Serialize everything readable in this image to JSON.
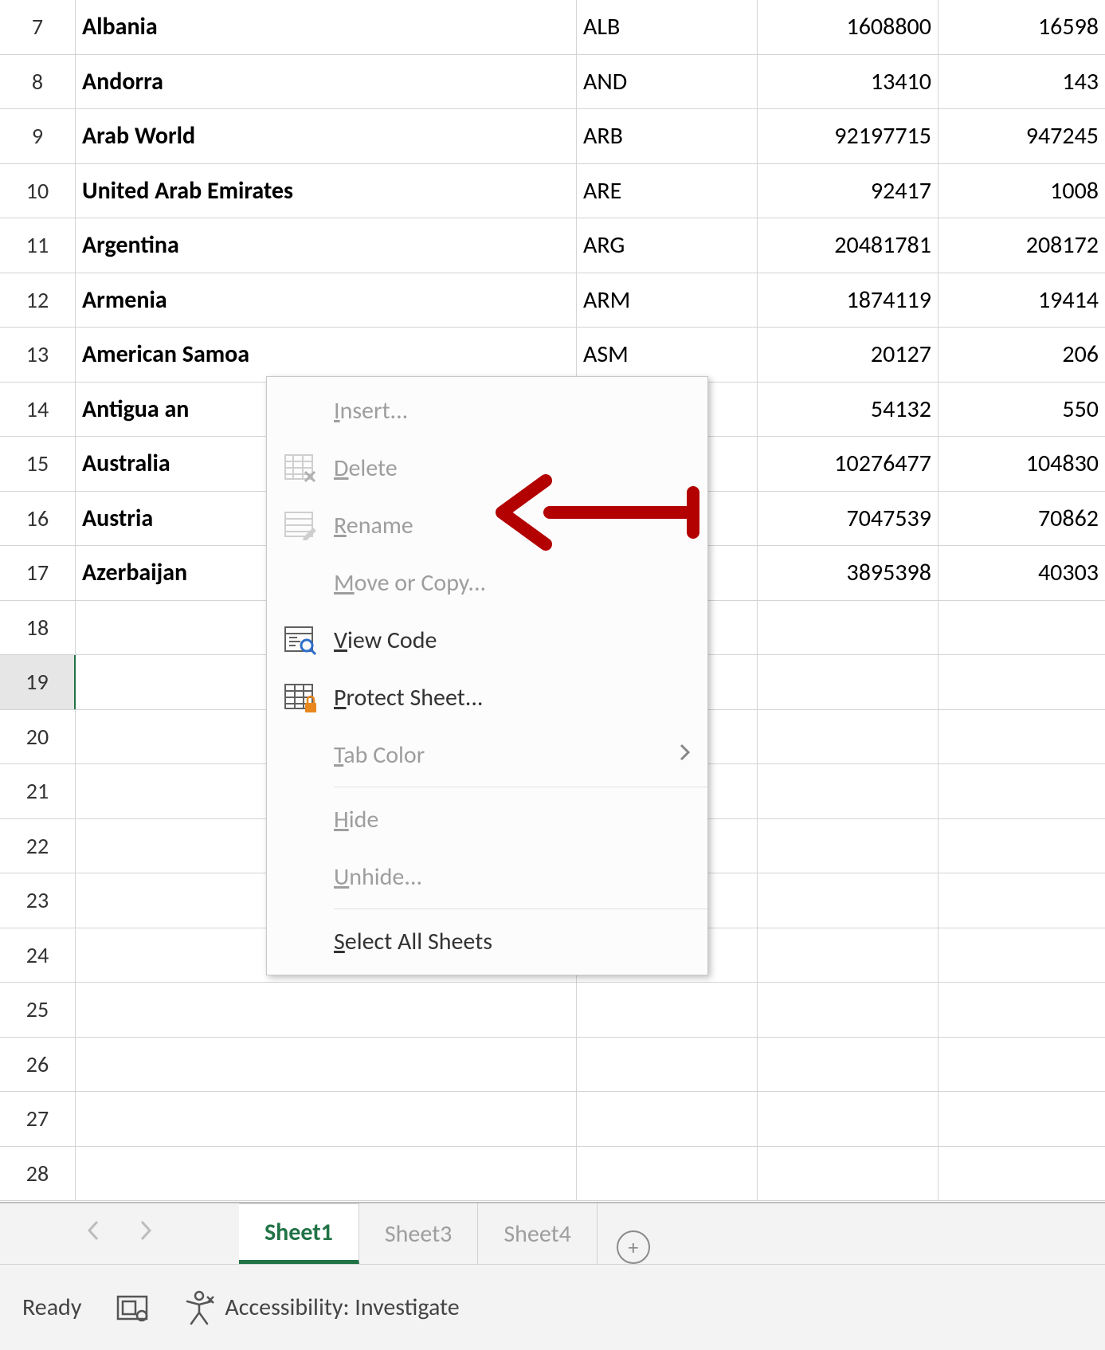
{
  "rows": [
    {
      "n": "7",
      "a": "Albania",
      "b": "ALB",
      "c": "1608800",
      "d": "16598"
    },
    {
      "n": "8",
      "a": "Andorra",
      "b": "AND",
      "c": "13410",
      "d": "143"
    },
    {
      "n": "9",
      "a": "Arab World",
      "b": "ARB",
      "c": "92197715",
      "d": "947245"
    },
    {
      "n": "10",
      "a": "United Arab Emirates",
      "b": "ARE",
      "c": "92417",
      "d": "1008"
    },
    {
      "n": "11",
      "a": "Argentina",
      "b": "ARG",
      "c": "20481781",
      "d": "208172"
    },
    {
      "n": "12",
      "a": "Armenia",
      "b": "ARM",
      "c": "1874119",
      "d": "19414"
    },
    {
      "n": "13",
      "a": "American Samoa",
      "b": "ASM",
      "c": "20127",
      "d": "206"
    },
    {
      "n": "14",
      "a": "Antigua an",
      "b": "",
      "c": "54132",
      "d": "550"
    },
    {
      "n": "15",
      "a": "Australia",
      "b": "",
      "c": "10276477",
      "d": "104830"
    },
    {
      "n": "16",
      "a": "Austria",
      "b": "",
      "c": "7047539",
      "d": "70862"
    },
    {
      "n": "17",
      "a": "Azerbaijan",
      "b": "",
      "c": "3895398",
      "d": "40303"
    },
    {
      "n": "18",
      "a": "",
      "b": "",
      "c": "",
      "d": ""
    },
    {
      "n": "19",
      "a": "",
      "b": "",
      "c": "",
      "d": "",
      "selected": true
    },
    {
      "n": "20",
      "a": "",
      "b": "",
      "c": "",
      "d": ""
    },
    {
      "n": "21",
      "a": "",
      "b": "",
      "c": "",
      "d": ""
    },
    {
      "n": "22",
      "a": "",
      "b": "",
      "c": "",
      "d": ""
    },
    {
      "n": "23",
      "a": "",
      "b": "",
      "c": "",
      "d": ""
    },
    {
      "n": "24",
      "a": "",
      "b": "",
      "c": "",
      "d": ""
    },
    {
      "n": "25",
      "a": "",
      "b": "",
      "c": "",
      "d": ""
    },
    {
      "n": "26",
      "a": "",
      "b": "",
      "c": "",
      "d": ""
    },
    {
      "n": "27",
      "a": "",
      "b": "",
      "c": "",
      "d": ""
    },
    {
      "n": "28",
      "a": "",
      "b": "",
      "c": "",
      "d": ""
    }
  ],
  "menu": {
    "insert": "Insert...",
    "delete": "Delete",
    "rename": "Rename",
    "move_copy": "Move or Copy...",
    "view_code": "View Code",
    "protect": "Protect Sheet...",
    "tab_color": "Tab Color",
    "hide": "Hide",
    "unhide": "Unhide...",
    "select_all": "Select All Sheets"
  },
  "tabs": {
    "sheet1": "Sheet1",
    "sheet3": "Sheet3",
    "sheet4": "Sheet4"
  },
  "status": {
    "ready": "Ready",
    "accessibility": "Accessibility: Investigate"
  }
}
